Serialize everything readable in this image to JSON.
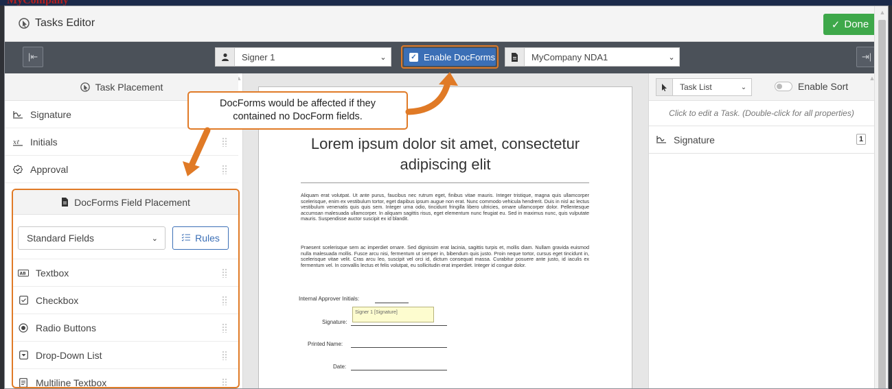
{
  "background": {
    "brand": "MyCompany"
  },
  "window": {
    "title": "Tasks Editor",
    "done_label": "Done"
  },
  "toolbar": {
    "signer": "Signer 1",
    "enable_docforms": "Enable DocForms",
    "document": "MyCompany NDA1"
  },
  "left_panel": {
    "title": "Task Placement",
    "items": [
      {
        "label": "Signature",
        "icon": "signature-icon"
      },
      {
        "label": "Initials",
        "icon": "initials-icon"
      },
      {
        "label": "Approval",
        "icon": "approval-icon"
      }
    ],
    "docforms": {
      "title": "DocForms Field Placement",
      "field_set": "Standard Fields",
      "rules_label": "Rules",
      "fields": [
        {
          "label": "Textbox",
          "icon": "textbox-icon"
        },
        {
          "label": "Checkbox",
          "icon": "checkbox-icon"
        },
        {
          "label": "Radio Buttons",
          "icon": "radio-icon"
        },
        {
          "label": "Drop-Down List",
          "icon": "dropdown-icon"
        },
        {
          "label": "Multiline Textbox",
          "icon": "multiline-icon"
        }
      ]
    }
  },
  "callout": {
    "text_line1": "DocForms would be affected if they",
    "text_line2": "contained no DocForm fields."
  },
  "document": {
    "title_line1": "Lorem ipsum dolor sit amet, consectetur",
    "title_line2": "adipiscing elit",
    "para1": "Aliquam erat volutpat. Ut ante purus, faucibus nec rutrum eget, finibus vitae mauris. Integer tristique, magna quis ullamcorper scelerisque, enim ex vestibulum tortor, eget dapibus ipsum augue non erat. Nunc commodo vehicula hendrerit. Duis in nisl ac lectus vestibulum venenatis quis quis sem. Integer urna odio, tincidunt fringilla libero ultricies, ornare ullamcorper dolor. Pellentesque accumsan malesuada ullamcorper. In aliquam sagittis risus, eget elementum nunc feugiat eu. Sed in maximus nunc, quis vulputate mauris. Suspendisse auctor suscipit ex id blandit.",
    "para2": "Praesent scelerisque sem ac imperdiet ornare. Sed dignissim erat lacinia, sagittis turpis et, mollis diam. Nullam gravida euismod nulla malesuada mollis. Fusce arcu nisi, fermentum ut semper in, bibendum quis justo. Proin neque tortor, cursus eget tincidunt in, scelerisque vitae velit. Cras arcu leo, suscipit vel orci id, dictum consequat massa. Curabitur posuere ante justo, id iaculis ex fermentum vel. In convallis lectus et felis volutpat, eu sollicitudin erat imperdiet. Integer id congue dolor.",
    "approver_label": "Internal Approver Initials:",
    "signature_label": "Signature:",
    "printed_name_label": "Printed Name:",
    "date_label": "Date:",
    "sig_tag": "Signer 1 [Signature]"
  },
  "right_panel": {
    "view": "Task List",
    "enable_sort": "Enable Sort",
    "hint": "Click to edit a Task. (Double-click for all properties)",
    "tasks": [
      {
        "label": "Signature",
        "count": "1",
        "icon": "signature-icon"
      }
    ]
  },
  "colors": {
    "accent_orange": "#e07a26",
    "done_green": "#3ea84a",
    "toolbar": "#4b5159",
    "primary_blue": "#3b6fb6"
  }
}
